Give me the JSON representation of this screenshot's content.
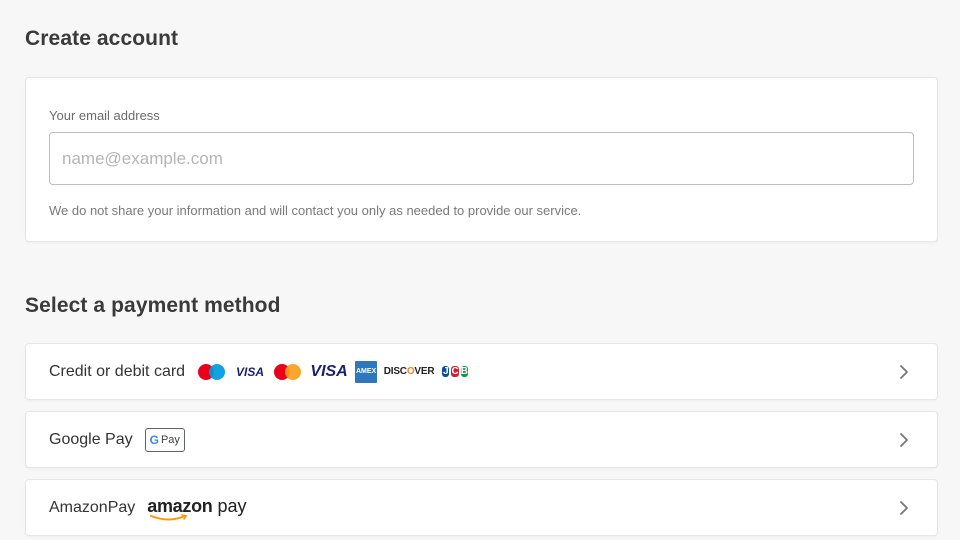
{
  "create_account": {
    "title": "Create account",
    "email_label": "Your email address",
    "email_value": "",
    "email_placeholder": "name@example.com",
    "email_help": "We do not share your information and will contact you only as needed to provide our service."
  },
  "payment": {
    "title": "Select a payment method",
    "methods": [
      {
        "label": "Credit or debit card",
        "brands": [
          "maestro",
          "visa-electron",
          "mastercard",
          "visa",
          "american-express",
          "discover",
          "jcb"
        ]
      },
      {
        "label": "Google Pay",
        "badge": "Pay"
      },
      {
        "label": "AmazonPay",
        "logo_word": "amazon",
        "logo_pay": "pay"
      }
    ]
  },
  "logos": {
    "visa_small": "VISA",
    "visa": "VISA",
    "amex": "AMEX",
    "discover_prefix": "DISC",
    "discover_o": "O",
    "discover_suffix": "VER",
    "jcb": [
      "J",
      "C",
      "B"
    ],
    "gpay_g": "G"
  },
  "colors": {
    "background": "#f7f7f7",
    "card": "#ffffff",
    "border": "#e6e6e6",
    "amazon_orange": "#ff9900",
    "visa_blue": "#1a1f71"
  },
  "icons": {
    "chevron": "chevron-right-icon"
  }
}
